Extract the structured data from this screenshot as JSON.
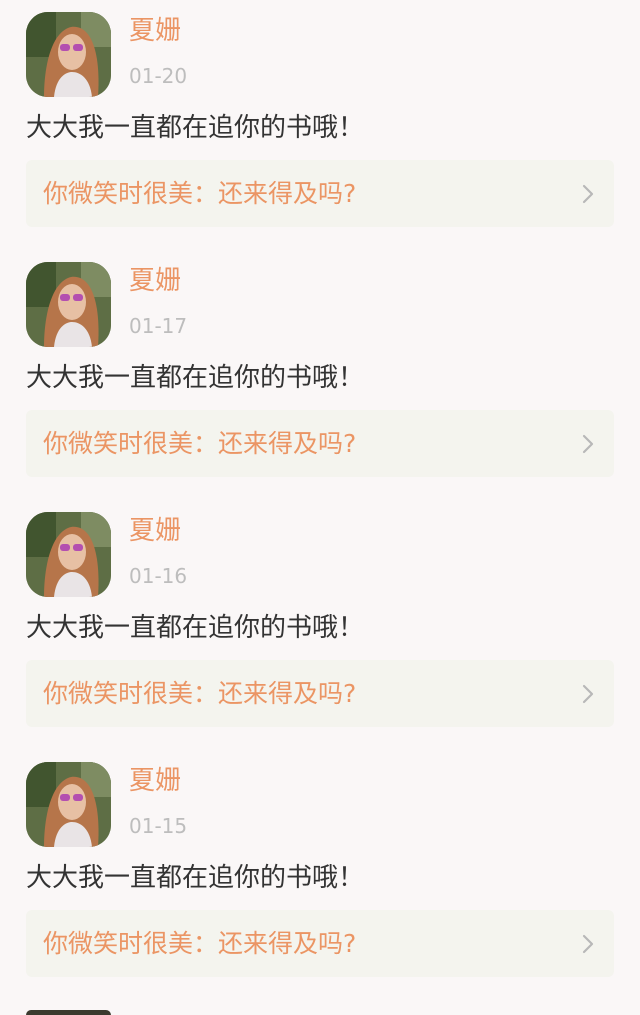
{
  "comments": [
    {
      "username": "夏姗",
      "date": "01-20",
      "text": "大大我一直都在追你的书哦！",
      "book_ref": "你微笑时很美：还来得及吗?"
    },
    {
      "username": "夏姗",
      "date": "01-17",
      "text": "大大我一直都在追你的书哦！",
      "book_ref": "你微笑时很美：还来得及吗?"
    },
    {
      "username": "夏姗",
      "date": "01-16",
      "text": "大大我一直都在追你的书哦！",
      "book_ref": "你微笑时很美：还来得及吗?"
    },
    {
      "username": "夏姗",
      "date": "01-15",
      "text": "大大我一直都在追你的书哦！",
      "book_ref": "你微笑时很美：还来得及吗?"
    }
  ],
  "icons": {
    "chevron": "chevron-right-icon"
  },
  "colors": {
    "accent": "#eb9564",
    "date": "#bdbdbd",
    "text": "#333333",
    "card_bg": "#f4f4ee",
    "page_bg": "#faf7f7"
  }
}
